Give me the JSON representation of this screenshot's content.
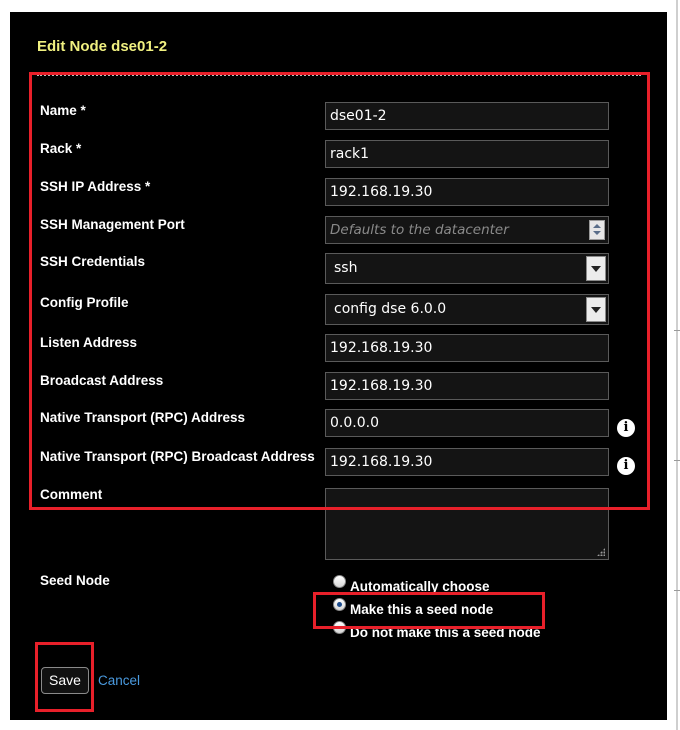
{
  "dialog": {
    "title": "Edit Node dse01-2"
  },
  "form": {
    "name": {
      "label": "Name *",
      "value": "dse01-2"
    },
    "rack": {
      "label": "Rack *",
      "value": "rack1"
    },
    "ssh_ip": {
      "label": "SSH IP Address *",
      "value": "192.168.19.30"
    },
    "ssh_port": {
      "label": "SSH Management Port",
      "placeholder": "Defaults to the datacenter",
      "value": ""
    },
    "ssh_credentials": {
      "label": "SSH Credentials",
      "selected": "ssh"
    },
    "config_profile": {
      "label": "Config Profile",
      "selected": "config dse 6.0.0"
    },
    "listen_address": {
      "label": "Listen Address",
      "value": "192.168.19.30"
    },
    "broadcast_address": {
      "label": "Broadcast Address",
      "value": "192.168.19.30"
    },
    "native_rpc_address": {
      "label": "Native Transport (RPC) Address",
      "value": "0.0.0.0"
    },
    "native_rpc_broadcast": {
      "label": "Native Transport (RPC) Broadcast Address",
      "value": "192.168.19.30"
    },
    "comment": {
      "label": "Comment",
      "value": ""
    },
    "seed_node": {
      "label": "Seed Node",
      "options": [
        "Automatically choose",
        "Make this a seed node",
        "Do not make this a seed node"
      ],
      "selected": "Make this a seed node"
    }
  },
  "icons": {
    "info": "info-icon",
    "info_glyph": "i"
  },
  "actions": {
    "save_label": "Save",
    "cancel_label": "Cancel"
  },
  "colors": {
    "title": "#f0f080",
    "highlight": "#e8202a",
    "link": "#4a9adf"
  }
}
